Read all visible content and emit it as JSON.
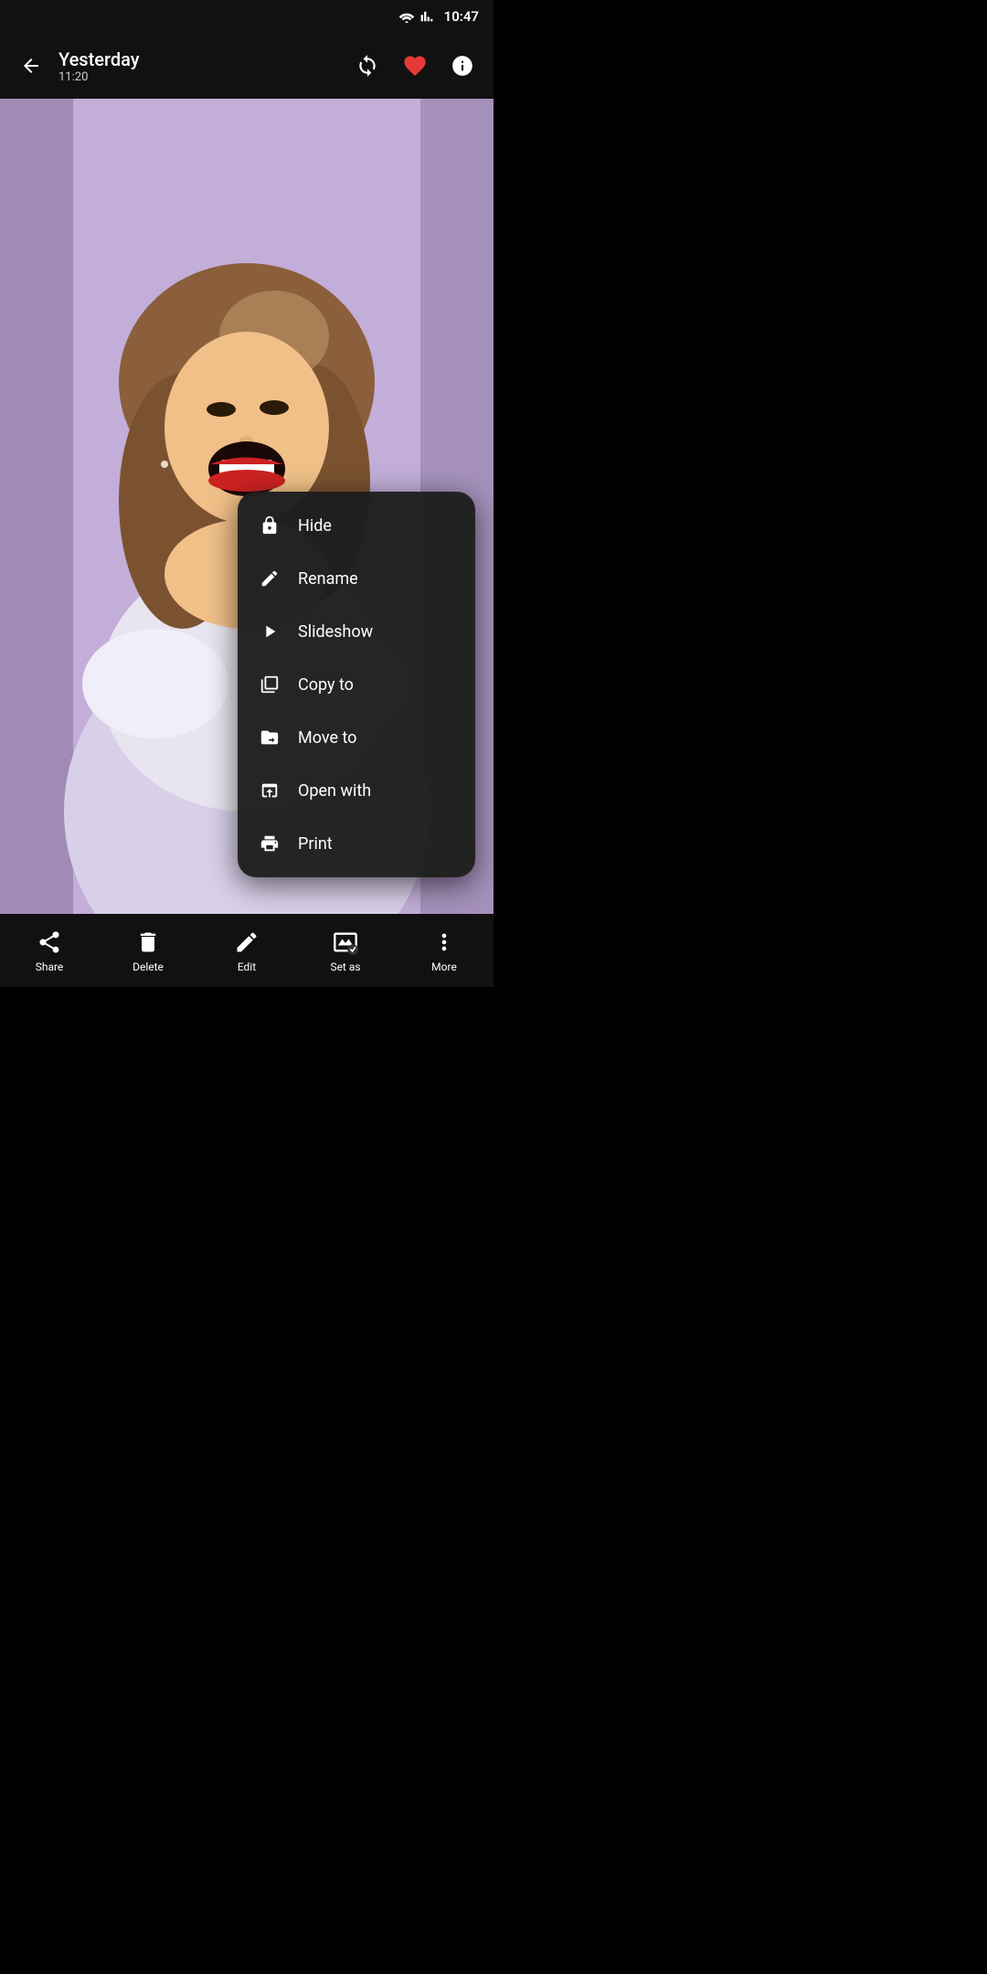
{
  "statusBar": {
    "time": "10:47"
  },
  "appBar": {
    "title": "Yesterday",
    "subtitle": "11:20"
  },
  "contextMenu": {
    "items": [
      {
        "id": "hide",
        "label": "Hide",
        "icon": "lock"
      },
      {
        "id": "rename",
        "label": "Rename",
        "icon": "edit"
      },
      {
        "id": "slideshow",
        "label": "Slideshow",
        "icon": "play"
      },
      {
        "id": "copy-to",
        "label": "Copy to",
        "icon": "copy"
      },
      {
        "id": "move-to",
        "label": "Move to",
        "icon": "move"
      },
      {
        "id": "open-with",
        "label": "Open with",
        "icon": "open"
      },
      {
        "id": "print",
        "label": "Print",
        "icon": "print"
      }
    ]
  },
  "bottomBar": {
    "actions": [
      {
        "id": "share",
        "label": "Share",
        "icon": "share"
      },
      {
        "id": "delete",
        "label": "Delete",
        "icon": "delete"
      },
      {
        "id": "edit",
        "label": "Edit",
        "icon": "edit"
      },
      {
        "id": "set-as",
        "label": "Set as",
        "icon": "set-as"
      },
      {
        "id": "more",
        "label": "More",
        "icon": "more"
      }
    ]
  }
}
